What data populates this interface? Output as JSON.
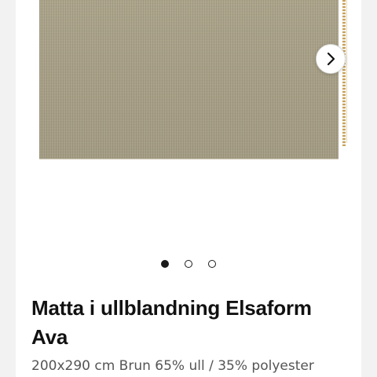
{
  "product": {
    "title": "Matta i ullblandning Elsaform Ava",
    "subtitle": "200x290 cm Brun 65% ull / 35% polyester"
  },
  "carousel": {
    "next_icon": "chevron-right-icon",
    "image_count": 3,
    "active_index": 0,
    "image_description_color": "#a79e84"
  }
}
